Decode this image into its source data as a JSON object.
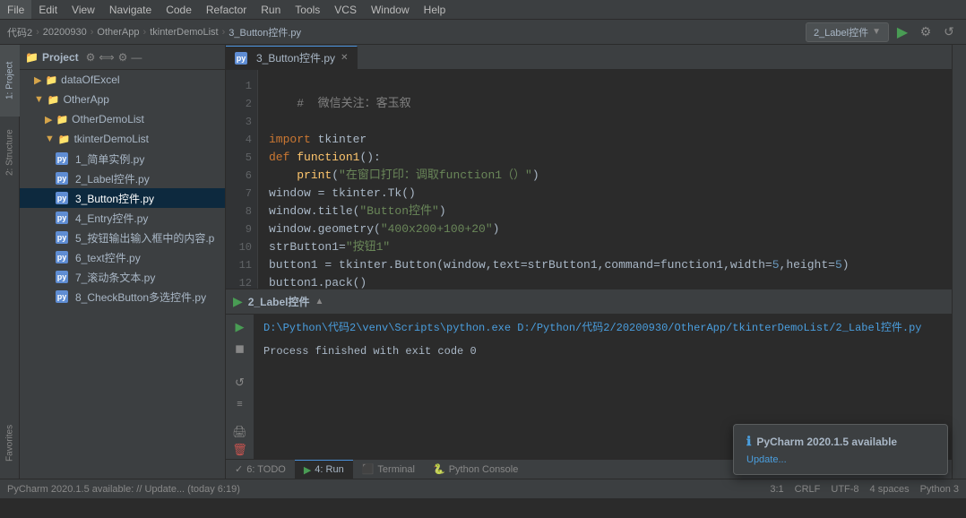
{
  "menubar": {
    "items": [
      "File",
      "Edit",
      "View",
      "Navigate",
      "Code",
      "Refactor",
      "Run",
      "Tools",
      "VCS",
      "Window",
      "Help"
    ]
  },
  "breadcrumb": {
    "parts": [
      "代码2",
      "20200930",
      "OtherApp",
      "tkinterDemoList",
      "3_Button控件.py"
    ]
  },
  "tabs": [
    {
      "label": "3_Button控件.py",
      "active": true
    }
  ],
  "runConfig": {
    "label": "2_Label控件"
  },
  "project": {
    "title": "Project",
    "items": [
      {
        "label": "dataOfExcel",
        "indent": 1,
        "type": "folder"
      },
      {
        "label": "OtherApp",
        "indent": 1,
        "type": "folder",
        "expanded": true
      },
      {
        "label": "OtherDemoList",
        "indent": 2,
        "type": "folder"
      },
      {
        "label": "tkinterDemoList",
        "indent": 2,
        "type": "folder",
        "expanded": true
      },
      {
        "label": "1_简单实例.py",
        "indent": 3,
        "type": "py"
      },
      {
        "label": "2_Label控件.py",
        "indent": 3,
        "type": "py"
      },
      {
        "label": "3_Button控件.py",
        "indent": 3,
        "type": "py",
        "active": true
      },
      {
        "label": "4_Entry控件.py",
        "indent": 3,
        "type": "py"
      },
      {
        "label": "5_按钮输出输入框中的内容.p",
        "indent": 3,
        "type": "py"
      },
      {
        "label": "6_text控件.py",
        "indent": 3,
        "type": "py"
      },
      {
        "label": "7_滚动条文本.py",
        "indent": 3,
        "type": "py"
      },
      {
        "label": "8_CheckButton多选控件.py",
        "indent": 3,
        "type": "py"
      }
    ]
  },
  "code": {
    "lines": [
      {
        "num": 1,
        "text": ""
      },
      {
        "num": 2,
        "text": "    #  微信关注：客玉叙"
      },
      {
        "num": 3,
        "text": ""
      },
      {
        "num": 4,
        "text": "import tkinter"
      },
      {
        "num": 5,
        "text": "def function1():"
      },
      {
        "num": 6,
        "text": "    print(\"在窗口打印：调取function1（）\")"
      },
      {
        "num": 7,
        "text": "window = tkinter.Tk()"
      },
      {
        "num": 8,
        "text": "window.title(\"Button控件\")"
      },
      {
        "num": 9,
        "text": "window.geometry(\"400x200+100+20\")"
      },
      {
        "num": 10,
        "text": "strButton1=\"按钮1\""
      },
      {
        "num": 11,
        "text": "button1 = tkinter.Button(window,text=strButton1,command=function1,width=5,height=5)"
      },
      {
        "num": 12,
        "text": "button1.pack()"
      }
    ]
  },
  "runPanel": {
    "title": "2_Label控件",
    "command": "D:\\Python\\代码2\\venv\\Scripts\\python.exe D:/Python/代码2/20200930/OtherApp/tkinterDemoList/2_Label控件.py",
    "output": "Process finished with exit code 0"
  },
  "bottomTabs": [
    {
      "label": "6: TODO",
      "active": false,
      "icon": "✓"
    },
    {
      "label": "4: Run",
      "active": true,
      "icon": "▶"
    },
    {
      "label": "Terminal",
      "active": false,
      "icon": "⬛"
    },
    {
      "label": "Python Console",
      "active": false,
      "icon": "🐍"
    }
  ],
  "statusBar": {
    "left": "PyCharm 2020.1.5 available: // Update... (today 6:19)",
    "items": [
      "3:1",
      "CRLF",
      "UTF-8",
      "4 spaces",
      "Python 3"
    ]
  },
  "notification": {
    "title": "PyCharm 2020.1.5 available",
    "link": "Update..."
  },
  "sidebarTabs": [
    {
      "label": "1: Project"
    },
    {
      "label": "2: Structure"
    },
    {
      "label": "Favorites"
    }
  ]
}
